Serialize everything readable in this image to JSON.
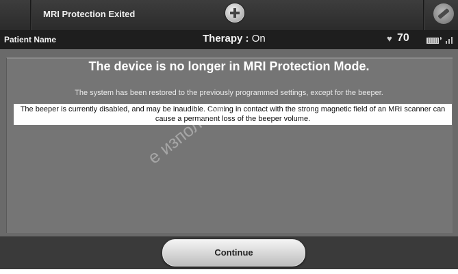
{
  "titlebar": {
    "title": "MRI Protection Exited"
  },
  "statusbar": {
    "patient_label": "Patient Name",
    "therapy_label": "Therapy : ",
    "therapy_value": "On",
    "heart_rate": "70"
  },
  "dialog": {
    "heading": "The device is no longer in MRI Protection Mode.",
    "restored_text": "The system has been restored to the previously programmed settings, except for the beeper.",
    "warning_text": "The beeper is currently disabled, and may be inaudible. Coming in contact with the strong magnetic field of an MRI scanner can cause a permanent loss of the beeper volume."
  },
  "actions": {
    "continue_label": "Continue"
  },
  "watermark": "е използва.",
  "icons": {
    "add": "plus-circle-icon",
    "tools": "wrench-icon",
    "heart": "heart-icon",
    "battery": "battery-icon",
    "telemetry": "telemetry-wave-icon",
    "signal": "signal-bars-icon"
  },
  "colors": {
    "titlebar": "#2f2f2f",
    "statusbar": "#1e1e1e",
    "panel": "#757575",
    "warning_background": "#ffffff"
  }
}
